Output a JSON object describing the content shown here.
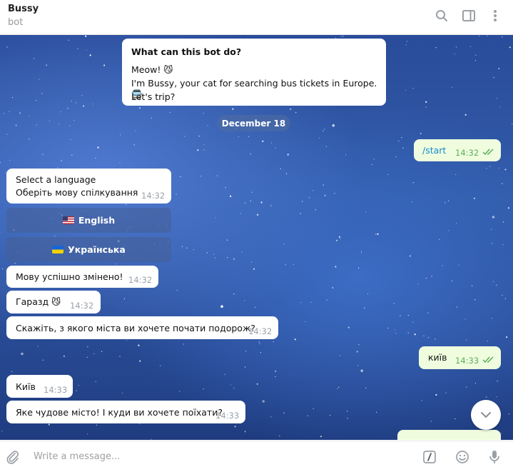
{
  "header": {
    "title": "Bussy",
    "subtitle": "bot",
    "icons": [
      "search-icon",
      "sidebar-toggle-icon",
      "more-vertical-icon"
    ]
  },
  "intro": {
    "heading": "What can this bot do?",
    "line1": "Meow! 😼",
    "line2": "I'm Bussy, your cat for searching bus tickets in Europe. 🚍",
    "line3": "Let's trip?"
  },
  "date_separator": "December 18",
  "messages": [
    {
      "direction": "out",
      "text": "/start",
      "time": "14:32"
    },
    {
      "direction": "in",
      "line1": "Select a language",
      "line2": "Оберіть мову спілкування",
      "time": "14:32"
    },
    {
      "direction": "in",
      "text": "Мову успішно змінено!",
      "time": "14:32"
    },
    {
      "direction": "in",
      "text": "Гаразд 😼",
      "time": "14:32"
    },
    {
      "direction": "in",
      "text": "Скажіть, з якого міста ви хочете почати подорож?",
      "time": "14:32"
    },
    {
      "direction": "out",
      "text": "київ",
      "time": "14:33"
    },
    {
      "direction": "in",
      "text": "Київ",
      "time": "14:33"
    },
    {
      "direction": "in",
      "text": "Яке чудове місто! І куди ви хочете поїхати?",
      "time": "14:33"
    }
  ],
  "keyboard": {
    "english_label": "English",
    "ukrainian_label": "Українська"
  },
  "composer": {
    "placeholder": "Write a message...",
    "icons": [
      "attach-icon",
      "commands-icon",
      "emoji-icon",
      "microphone-icon"
    ]
  },
  "colors": {
    "incoming_bubble": "#ffffff",
    "outgoing_bubble": "#effdde",
    "read_check": "#5fad5f"
  }
}
